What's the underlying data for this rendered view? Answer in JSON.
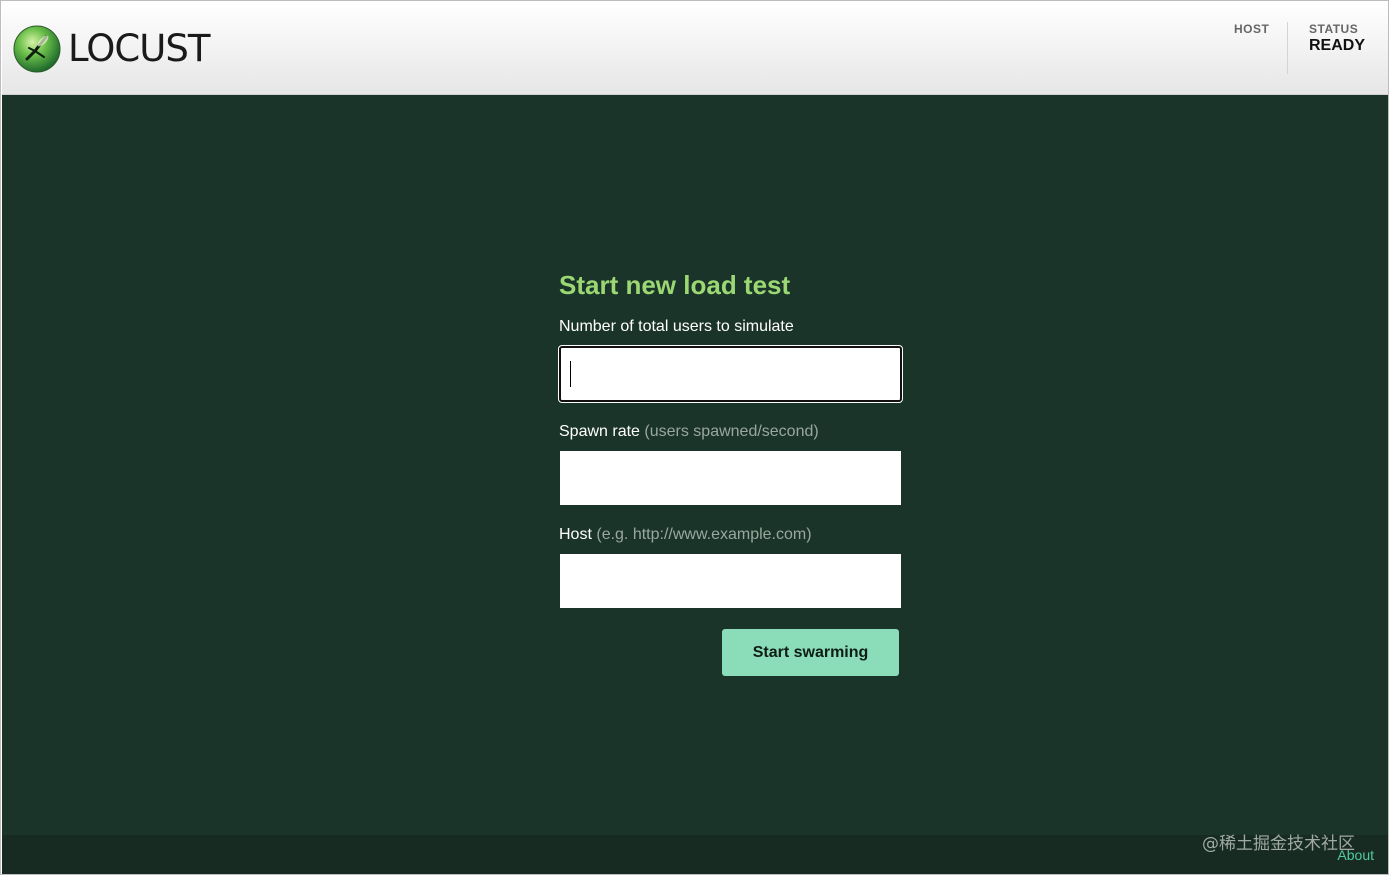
{
  "header": {
    "logo_text": "LOCUST",
    "host_label": "HOST",
    "status_label": "STATUS",
    "status_value": "READY"
  },
  "form": {
    "title": "Start new load test",
    "users_label": "Number of total users to simulate",
    "users_value": "",
    "spawn_label": "Spawn rate",
    "spawn_hint": "(users spawned/second)",
    "spawn_value": "",
    "host_label": "Host",
    "host_hint": "(e.g. http://www.example.com)",
    "host_value": "",
    "submit_label": "Start swarming"
  },
  "footer": {
    "about_label": "About"
  },
  "watermark": "@稀土掘金技术社区",
  "colors": {
    "header_bg": "#f0f0f0",
    "main_bg": "#1b342a",
    "title_green": "#9bd873",
    "button_bg": "#8bdcb8",
    "about_link": "#51c89d"
  },
  "icons": {
    "logo": "locust-logo-icon"
  }
}
